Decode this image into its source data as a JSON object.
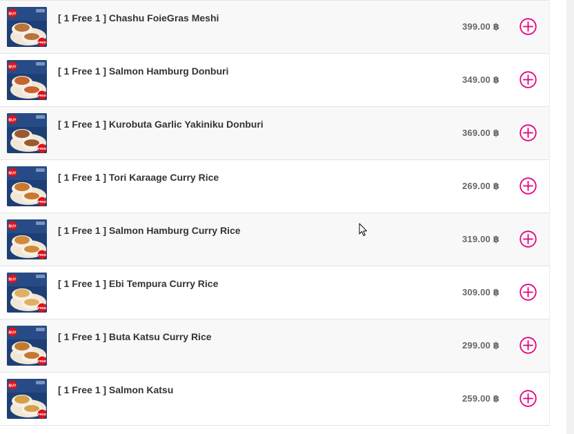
{
  "menu": {
    "accent_color": "#e4007f",
    "items": [
      {
        "name": "[ 1 Free 1 ] Chashu FoieGras Meshi",
        "price": "399.00 ฿",
        "add_icon": "plus-circle-icon"
      },
      {
        "name": "[ 1 Free 1 ] Salmon Hamburg Donburi",
        "price": "349.00 ฿",
        "add_icon": "plus-circle-icon"
      },
      {
        "name": "[ 1 Free 1 ] Kurobuta Garlic Yakiniku Donburi",
        "price": "369.00 ฿",
        "add_icon": "plus-circle-icon"
      },
      {
        "name": "[ 1 Free 1 ] Tori Karaage Curry Rice",
        "price": "269.00 ฿",
        "add_icon": "plus-circle-icon"
      },
      {
        "name": "[ 1 Free 1 ] Salmon Hamburg Curry Rice",
        "price": "319.00 ฿",
        "add_icon": "plus-circle-icon"
      },
      {
        "name": "[ 1 Free 1 ] Ebi Tempura Curry Rice",
        "price": "309.00 ฿",
        "add_icon": "plus-circle-icon"
      },
      {
        "name": "[ 1 Free 1 ] Buta Katsu Curry Rice",
        "price": "299.00 ฿",
        "add_icon": "plus-circle-icon"
      },
      {
        "name": "[ 1 Free 1 ] Salmon Katsu",
        "price": "259.00 ฿",
        "add_icon": "plus-circle-icon"
      }
    ],
    "thumbnail_badges": {
      "top": "BUY",
      "bottom": "FREE"
    }
  }
}
